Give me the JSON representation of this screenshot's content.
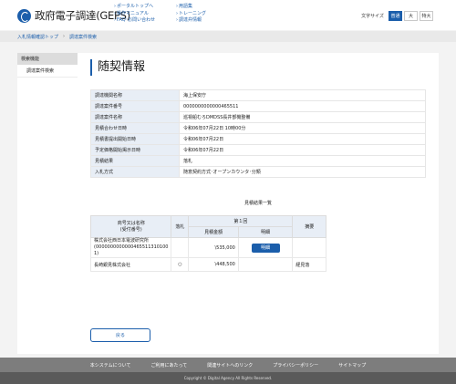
{
  "header": {
    "logo_text": "政府電子調達(GEPS)",
    "links_col1": [
      "ポータルトップへ",
      "操作マニュアル",
      "FAQ･お問い合わせ"
    ],
    "links_col2": [
      "用語集",
      "トレーニング",
      "調達弁情報"
    ],
    "font_size": {
      "label": "文字サイズ",
      "options": [
        "普通",
        "大",
        "特大"
      ],
      "selected": "普通"
    }
  },
  "breadcrumb": {
    "items": [
      "入札情報確認トップ",
      "調達案件検索"
    ]
  },
  "sidebar": {
    "heading": "検索機能",
    "items": [
      "調達案件検索"
    ]
  },
  "main": {
    "title": "随契情報",
    "info_rows": [
      {
        "label": "調達機関名称",
        "value": "海上保安庁"
      },
      {
        "label": "調達案件番号",
        "value": "0000000000000465511"
      },
      {
        "label": "調達案件名称",
        "value": "巡視船むろDMDSS長井部機整備"
      },
      {
        "label": "見積合わせ日時",
        "value": "令和06年07月22日 10時00分"
      },
      {
        "label": "見積書提出開始日時",
        "value": "令和06年07月22日"
      },
      {
        "label": "予定価格開始掲示日時",
        "value": "令和06年07月22日"
      },
      {
        "label": "見積結果",
        "value": "落札"
      },
      {
        "label": "入札方式",
        "value": "随意契約方式･オープンカウンタ･分類"
      }
    ],
    "results_title": "見積結果一覧",
    "results_table": {
      "col_company": "商号又は名称\n(受付番号)",
      "col_award": "落札",
      "col_round": "第１回",
      "col_amount": "見積金額",
      "col_detail": "明細",
      "col_remarks": "摘要",
      "rows": [
        {
          "company": "株式会社西日本電波研究所",
          "receipt": "(0000000000000465511310100​1)",
          "award": "",
          "amount": "\\535,000",
          "detail_button": "明細",
          "remarks": ""
        },
        {
          "company": "長崎銀見株式会社",
          "receipt": "",
          "award": "○",
          "amount": "\\448,500",
          "detail_button": "",
          "remarks": "経見落"
        }
      ]
    },
    "back_button": "戻る"
  },
  "footer": {
    "links": [
      "本システムについて",
      "ご利用にあたって",
      "関連サイトへのリンク",
      "プライバシーポリシー",
      "サイトマップ"
    ],
    "copyright": "Copyright © Digital Agency All Rights Reserved."
  }
}
